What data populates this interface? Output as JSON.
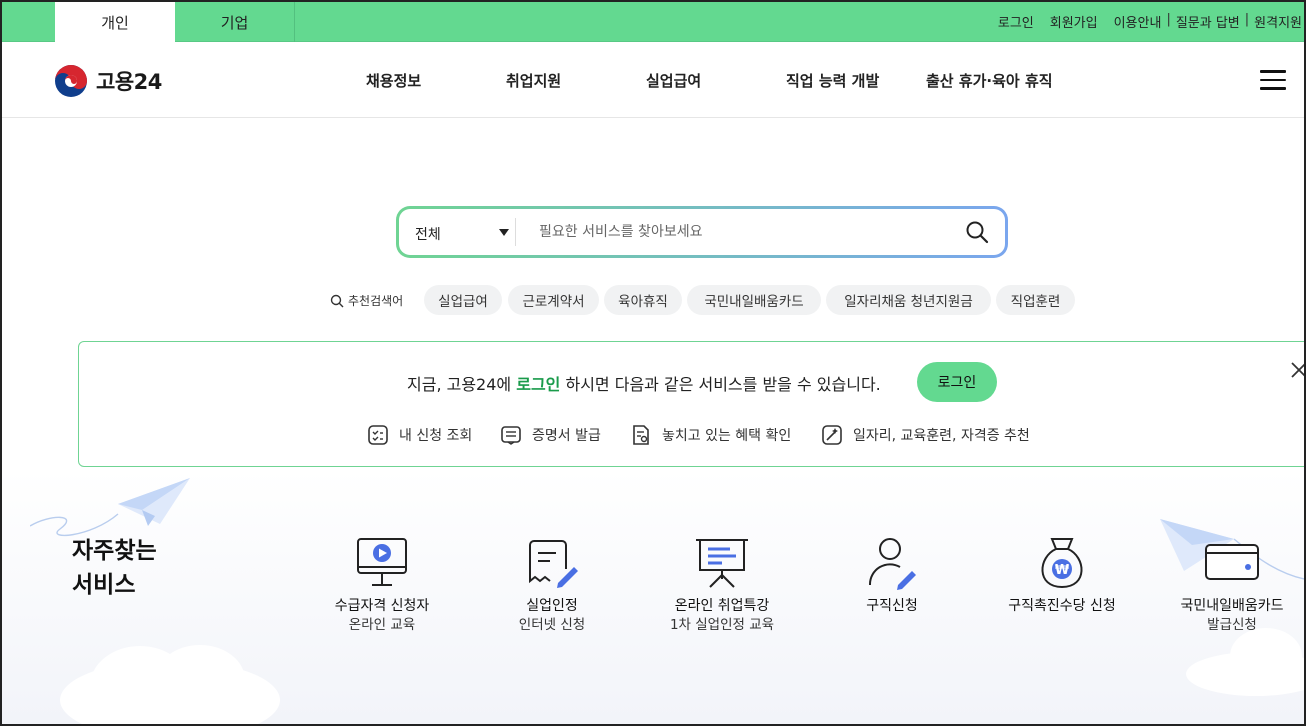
{
  "topbar": {
    "tabs": [
      {
        "label": "개인",
        "active": true
      },
      {
        "label": "기업",
        "active": false
      }
    ],
    "links": {
      "login": "로그인",
      "signup": "회원가입",
      "guide": "이용안내",
      "qna": "질문과 답변",
      "remote": "원격지원"
    },
    "accent": "#63d990"
  },
  "header": {
    "logo_text": "고용24",
    "nav": [
      "채용정보",
      "취업지원",
      "실업급여",
      "직업 능력 개발",
      "출산 휴가·육아 휴직"
    ],
    "menu_icon": "hamburger-icon"
  },
  "search": {
    "category": "전체",
    "placeholder": "필요한 서비스를 찾아보세요",
    "value": ""
  },
  "keywords": {
    "label": "추천검색어",
    "items": [
      "실업급여",
      "근로계약서",
      "육아휴직",
      "국민내일배움카드",
      "일자리채움 청년지원금",
      "직업훈련"
    ]
  },
  "banner": {
    "msg_pre": "지금, 고용24에 ",
    "msg_link": "로그인",
    "msg_post": " 하시면 다음과 같은 서비스를 받을 수 있습니다.",
    "button": "로그인",
    "features": [
      "내 신청 조회",
      "증명서 발급",
      "놓치고 있는 혜택 확인",
      "일자리, 교육훈련, 자격증 추천"
    ]
  },
  "favorites": {
    "title_line1": "자주찾는",
    "title_line2": "서비스",
    "items": [
      {
        "line1": "수급자격 신청자",
        "line2": "온라인 교육",
        "icon": "video-monitor-icon"
      },
      {
        "line1": "실업인정",
        "line2": "인터넷 신청",
        "icon": "document-pen-icon"
      },
      {
        "line1": "온라인 취업특강",
        "line2": "1차 실업인정 교육",
        "icon": "presentation-board-icon"
      },
      {
        "line1": "구직신청",
        "line2": "",
        "icon": "person-pen-icon"
      },
      {
        "line1": "구직촉진수당 신청",
        "line2": "",
        "icon": "money-bag-icon"
      },
      {
        "line1": "국민내일배움카드",
        "line2": "발급신청",
        "icon": "card-icon"
      }
    ]
  }
}
